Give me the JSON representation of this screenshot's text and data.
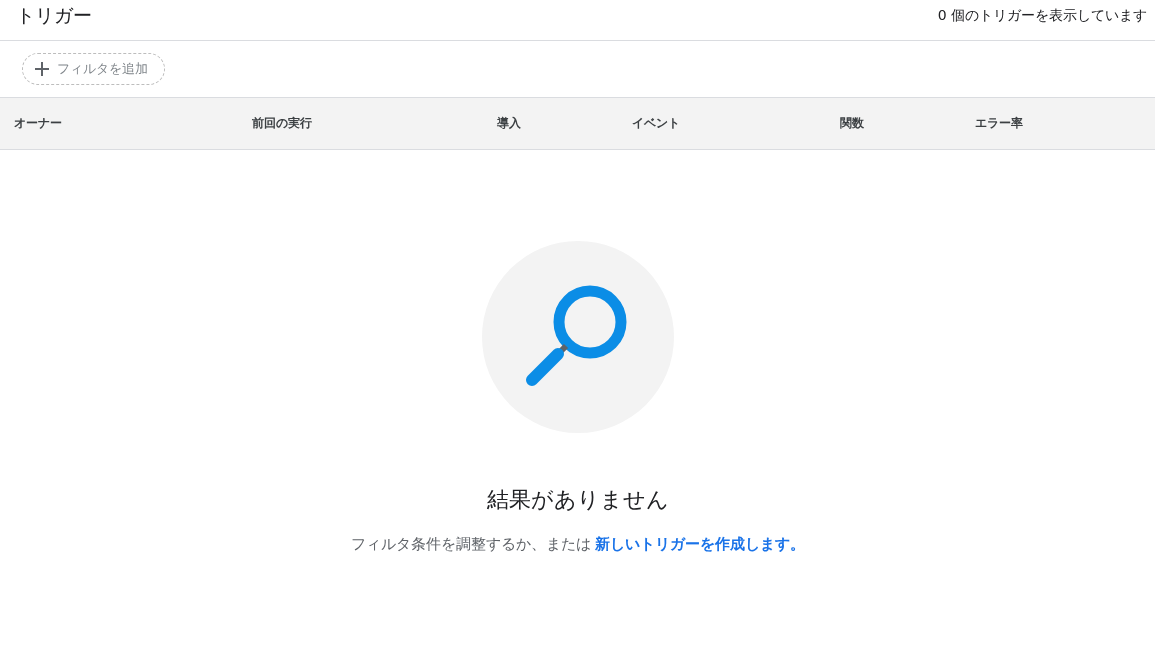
{
  "header": {
    "title": "トリガー",
    "count": "0 個のトリガーを表示しています"
  },
  "filter_button": {
    "label": "フィルタを追加"
  },
  "table": {
    "columns": [
      "オーナー",
      "前回の実行",
      "導入",
      "イベント",
      "関数",
      "エラー率"
    ]
  },
  "empty_state": {
    "title": "結果がありません",
    "message": "フィルタ条件を調整するか、または",
    "link": "新しいトリガーを作成します。"
  }
}
